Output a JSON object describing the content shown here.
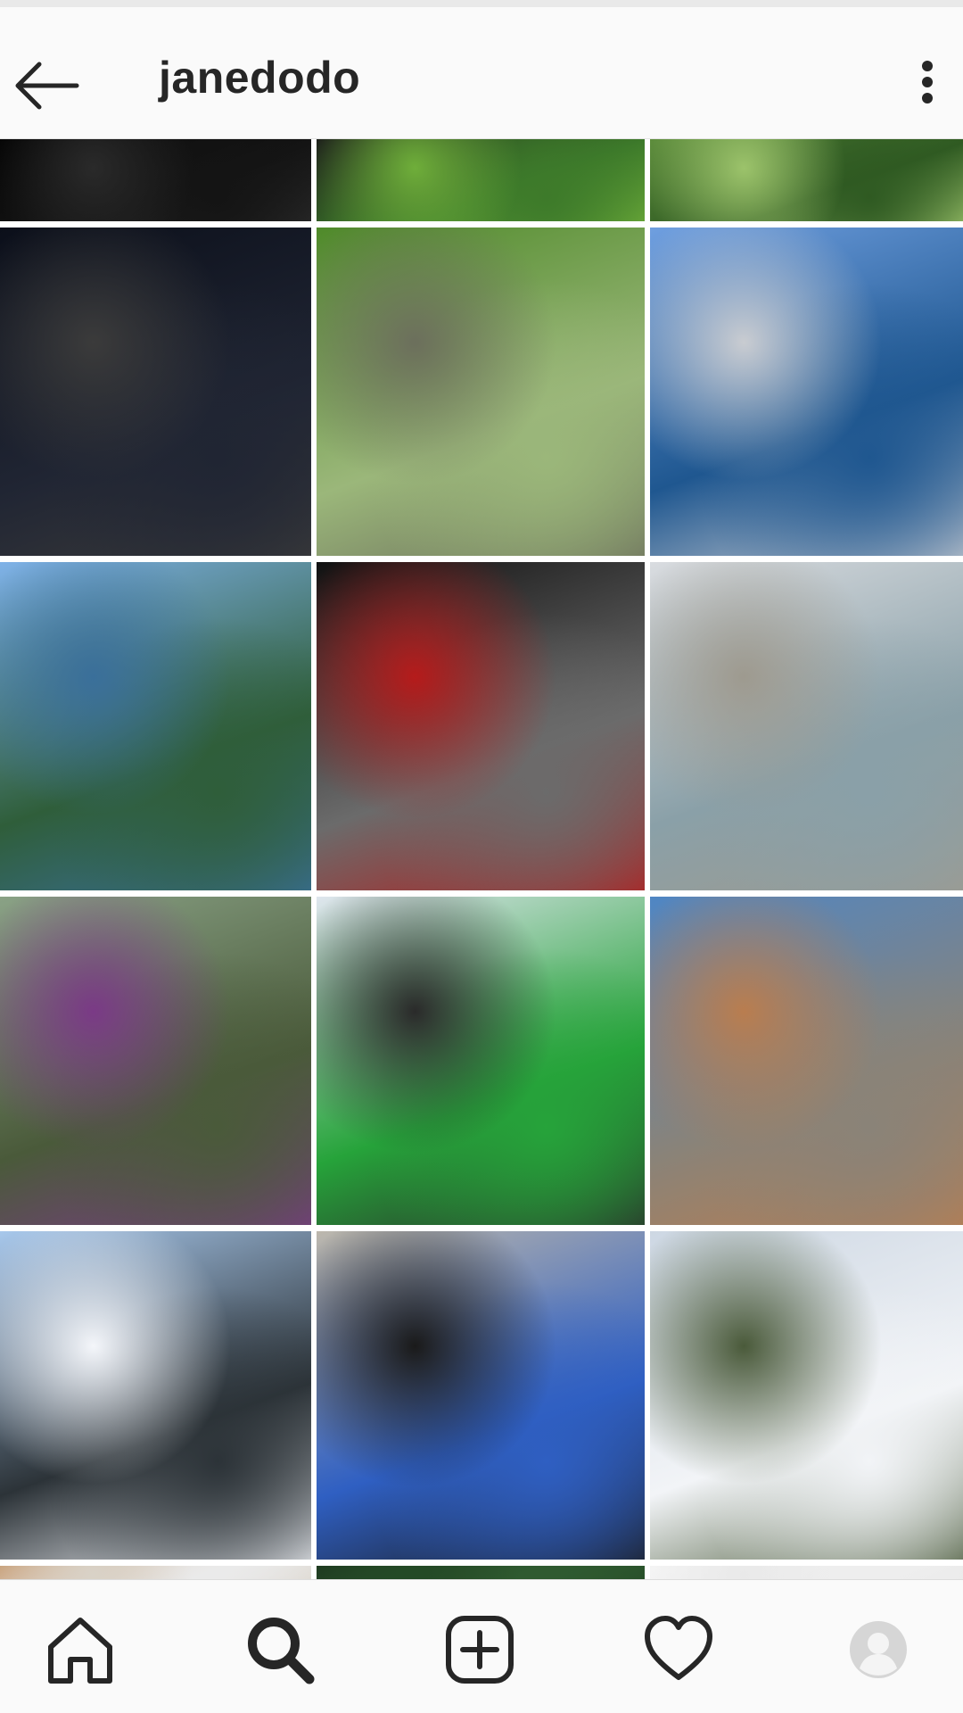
{
  "header": {
    "username": "janedodo",
    "back_icon": "arrow-left-icon",
    "more_icon": "more-vertical-icon"
  },
  "grid": {
    "tiles": [
      {
        "name": "post-night-street-partial",
        "colors": [
          "#050505",
          "#141414",
          "#2a2a2a"
        ]
      },
      {
        "name": "post-black-dog-grass-partial",
        "colors": [
          "#1a1a1a",
          "#3d7a2a",
          "#6fae3a"
        ]
      },
      {
        "name": "post-pine-branches-partial",
        "colors": [
          "#5a8a3a",
          "#2f5a22",
          "#9cc36b"
        ]
      },
      {
        "name": "post-graduation-night",
        "colors": [
          "#0b0f1a",
          "#202533",
          "#3b3b3b"
        ]
      },
      {
        "name": "post-forest-creek-hiker",
        "colors": [
          "#4f8a2a",
          "#9bb77a",
          "#6c6f5c"
        ]
      },
      {
        "name": "post-lake-dock",
        "colors": [
          "#6f9fe0",
          "#1f5790",
          "#c9ccd1"
        ]
      },
      {
        "name": "post-lakeshore-rocks",
        "colors": [
          "#7fb2e8",
          "#2f5e3a",
          "#3a6f9a"
        ]
      },
      {
        "name": "post-dog-red-jacket",
        "colors": [
          "#111111",
          "#6b6b6b",
          "#b51b1b"
        ]
      },
      {
        "name": "post-dock-sitting",
        "colors": [
          "#d9dce0",
          "#8aa0a8",
          "#9e9a8f"
        ]
      },
      {
        "name": "post-winter-smile",
        "colors": [
          "#8aa286",
          "#4a5a3a",
          "#7a3a86"
        ]
      },
      {
        "name": "post-vikes-team",
        "colors": [
          "#dfe6ee",
          "#26a33a",
          "#2a2a2a"
        ]
      },
      {
        "name": "post-mountain-summit",
        "colors": [
          "#4f86c4",
          "#8a8378",
          "#b97d4f"
        ]
      },
      {
        "name": "post-ski-group",
        "colors": [
          "#a8c8ec",
          "#2c3338",
          "#f4f6fa"
        ]
      },
      {
        "name": "post-blue-team-photo",
        "colors": [
          "#bdb8ad",
          "#2f5fc2",
          "#1a1a1a"
        ]
      },
      {
        "name": "post-snow-dog",
        "colors": [
          "#cdd7e3",
          "#f2f4f7",
          "#4a5a3a"
        ]
      },
      {
        "name": "post-partial-1",
        "colors": [
          "#c9a27c",
          "#eaeaea",
          "#d9d2c7"
        ]
      },
      {
        "name": "post-partial-2",
        "colors": [
          "#1e3a20",
          "#2f5a30",
          "#244a26"
        ]
      },
      {
        "name": "post-partial-3",
        "colors": [
          "#f5f5f5",
          "#eeeeee",
          "#e9e9e9"
        ]
      }
    ]
  },
  "bottom_nav": {
    "items": [
      {
        "name": "nav-home",
        "icon": "home-icon"
      },
      {
        "name": "nav-search",
        "icon": "search-icon"
      },
      {
        "name": "nav-new-post",
        "icon": "add-post-icon"
      },
      {
        "name": "nav-activity",
        "icon": "heart-icon"
      },
      {
        "name": "nav-profile",
        "icon": "profile-avatar-icon"
      }
    ]
  }
}
